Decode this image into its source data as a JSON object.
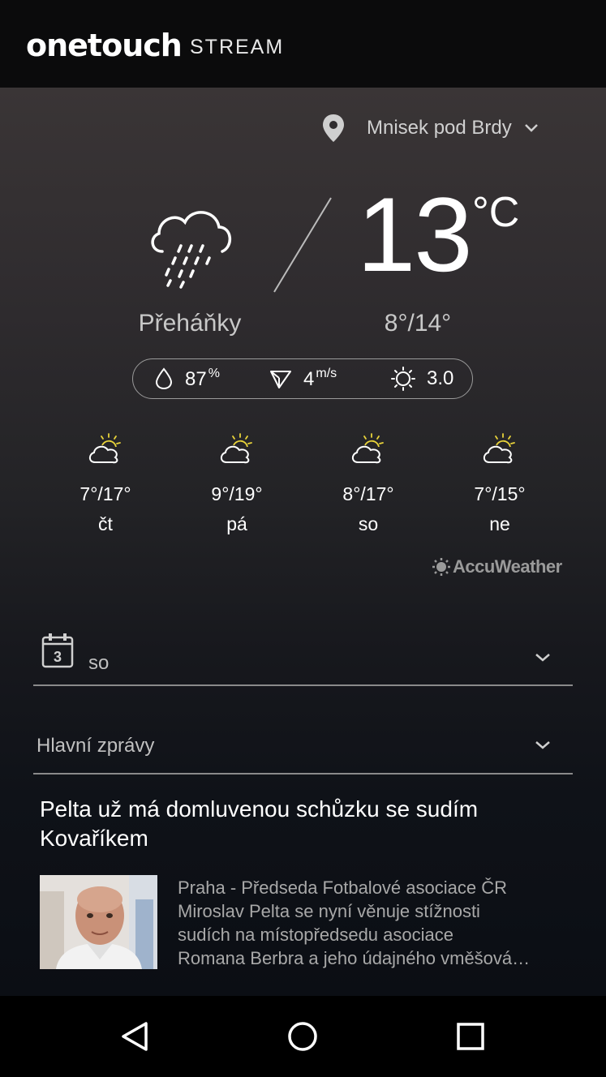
{
  "header": {
    "brand": "onetouch",
    "brand_sub": "STREAM"
  },
  "weather": {
    "location": "Mnisek pod Brdy",
    "location_icon": "location-pin-icon",
    "temperature": "13",
    "unit": "°C",
    "condition": "Přeháňky",
    "condition_icon": "cloud-rain-icon",
    "min_max": "8°/14°",
    "humidity": "87",
    "humidity_unit": "%",
    "wind": "4",
    "wind_unit": "m/s",
    "uv": "3.0",
    "forecast": [
      {
        "temps": "7°/17°",
        "day": "čt",
        "icon": "partly-sunny-icon"
      },
      {
        "temps": "9°/19°",
        "day": "pá",
        "icon": "partly-sunny-icon"
      },
      {
        "temps": "8°/17°",
        "day": "so",
        "icon": "partly-sunny-icon"
      },
      {
        "temps": "7°/15°",
        "day": "ne",
        "icon": "partly-sunny-icon"
      }
    ],
    "provider": "AccuWeather"
  },
  "calendar": {
    "label": "so",
    "icon_day": "3"
  },
  "news": {
    "category": "Hlavní zprávy",
    "headline": "Pelta už má domluvenou schůzku se sudím Kovaříkem",
    "summary_lines": [
      "Praha - Předseda Fotbalové asociace ČR",
      "Miroslav Pelta se nyní věnuje stížnosti",
      "sudích na místopředsedu asociace",
      "Romana Berbra a jeho údajného vměšová…"
    ]
  },
  "colors": {
    "accent_sun": "#e8d33a",
    "background_top": "#3a3536",
    "background_bottom": "#0b0e14"
  }
}
